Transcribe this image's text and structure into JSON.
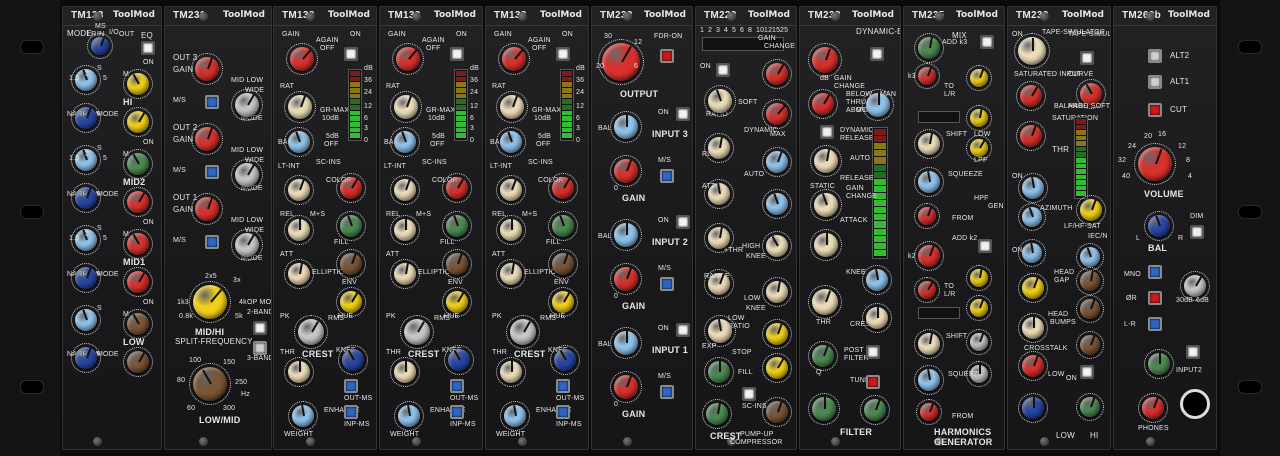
{
  "rack": {
    "brand": "ToolMod",
    "modules": [
      {
        "id": "tm133",
        "name": "TM133",
        "x": 0,
        "labels": [
          "MODE",
          "MS",
          "LR",
          "IN",
          "I/O",
          "OUT",
          "EQ",
          "HI",
          "S",
          "M",
          "MODE",
          "NARROW",
          "MID2",
          "S",
          "M",
          "MODE",
          "NARROW",
          "MID1",
          "S",
          "M",
          "MODE",
          "NARROW",
          "LOW",
          "S",
          "M",
          "MODE",
          "NARROW",
          "ON",
          "ON",
          "ON",
          "ON",
          "1.5",
          "3",
          "5",
          "1.5",
          "3",
          "5",
          "1.5",
          "3",
          "5"
        ]
      },
      {
        "id": "tm231",
        "name": "TM231",
        "labels": [
          "OUT 3",
          "GAIN",
          "M/S",
          "MID LOW",
          "WIDE",
          "MODE",
          "OUT 2",
          "GAIN",
          "M/S",
          "MID LOW",
          "WIDE",
          "MODE",
          "OUT 1",
          "GAIN",
          "M/S",
          "MID LOW",
          "WIDE",
          "MODE",
          "2x5",
          "3x",
          "1k3",
          "4k",
          "0.8k",
          "5k",
          "MID/HI",
          "SPLIT-FREQUENCY",
          "OP MODE",
          "2-BAND",
          "3-BAND",
          "100",
          "150",
          "80",
          "250",
          "60",
          "300",
          "Hz",
          "LOW/MID"
        ]
      },
      {
        "id": "tm132a",
        "name": "TM132",
        "labels": [
          "GAIN",
          "AGAIN",
          "OFF",
          "ON",
          "RAT",
          "GR-MAX",
          "10dB",
          "BAL",
          "5dB",
          "OFF",
          "SC-INS",
          "LT-INT",
          "COLOR",
          "REL",
          "M+S",
          "ATT",
          "ELLIPTIC",
          "FILL",
          "ENV",
          "HUE",
          "PK",
          "RMS",
          "CREST",
          "THR",
          "KNEE",
          "OUT-MS",
          "ENHANCE",
          "INP-MS",
          "WEIGHT",
          "dB",
          "36",
          "24",
          "12",
          "6",
          "3",
          "0"
        ]
      },
      {
        "id": "tm132b",
        "name": "TM132",
        "labels": [
          "GAIN",
          "AGAIN",
          "OFF",
          "ON",
          "RAT",
          "GR-MAX",
          "10dB",
          "BAL",
          "5dB",
          "OFF",
          "SC-INS",
          "LT-INT",
          "COLOR",
          "REL",
          "M+S",
          "ATT",
          "ELLIPTIC",
          "FILL",
          "ENV",
          "HUE",
          "PK",
          "RMS",
          "CREST",
          "THR",
          "KNEE",
          "OUT-MS",
          "ENHANCE",
          "INP-MS",
          "WEIGHT",
          "dB",
          "36",
          "24",
          "12",
          "6",
          "3",
          "0"
        ]
      },
      {
        "id": "tm132c",
        "name": "TM132",
        "labels": [
          "GAIN",
          "AGAIN",
          "OFF",
          "ON",
          "RAT",
          "GR-MAX",
          "10dB",
          "BAL",
          "5dB",
          "OFF",
          "SC-INS",
          "LT-INT",
          "COLOR",
          "REL",
          "M+S",
          "ATT",
          "ELLIPTIC",
          "FILL",
          "ENV",
          "HUE",
          "PK",
          "RMS",
          "CREST",
          "THR",
          "KNEE",
          "OUT-MS",
          "ENHANCE",
          "INP-MS",
          "WEIGHT",
          "dB",
          "36",
          "24",
          "12",
          "6",
          "3",
          "0"
        ]
      },
      {
        "id": "tm232",
        "name": "TM232",
        "labels": [
          "OUTPUT",
          "FDR-ON",
          "INPUT 3",
          "BAL",
          "GAIN",
          "M/S",
          "ON",
          "INPUT 2",
          "BAL",
          "GAIN",
          "M/S",
          "ON",
          "INPUT 1",
          "BAL",
          "GAIN",
          "M/S",
          "ON",
          "±dB",
          "0",
          "20",
          "30",
          "12",
          "6"
        ]
      },
      {
        "id": "tm223",
        "name": "TM223",
        "labels": [
          "GAIN",
          "CHANGE",
          "ON",
          "RATIO",
          "SOFT",
          "DYNAMIC",
          "MAX",
          "REL",
          "AUTO",
          "ATT",
          "+THR",
          "HIGH",
          "KNEE",
          "RANGE",
          "LOW",
          "KNEE",
          "LOW",
          "RATIO",
          "EXP",
          "STOP",
          "FILL",
          "SC-INS",
          "CREST",
          "PUMP-UP",
          "COMPRESSOR",
          "1",
          "2",
          "3",
          "4",
          "5",
          "6",
          "8",
          "10",
          "12",
          "15",
          "25"
        ]
      },
      {
        "id": "tm238",
        "name": "TM238",
        "labels": [
          "DYNAMIC-EQ",
          "GAIN",
          "CHANGE",
          "BELOW",
          "THRU",
          "ABOVE",
          "MODE",
          "MAN",
          "DYNAMIC",
          "RELEASE",
          "AUTO",
          "STATIC",
          "RELEASE",
          "GAIN",
          "CHANGE",
          "ATTACK",
          "KNEE",
          "THR",
          "CREST",
          "POST",
          "FILTER",
          "TUNE",
          "FILTER",
          "Q",
          "dB"
        ]
      },
      {
        "id": "tm235",
        "name": "TM235",
        "labels": [
          "MIX",
          "ADD k3",
          "TO",
          "L/R",
          "SHIFT",
          "SQUEEZE",
          "FROM",
          "ADD k2",
          "TO",
          "L/R",
          "SHIFT",
          "SQUEEZE",
          "FROM",
          "k3",
          "k2",
          "LOW",
          "LPF",
          "HPF",
          "HARMONICS",
          "GENERATOR"
        ]
      },
      {
        "id": "tm233",
        "name": "TM233",
        "labels": [
          "TAPE-SIMULATOR",
          "SATURATED INPUT",
          "CURVE",
          "BALANCE",
          "HARD SOFT",
          "SATURATION",
          "THR",
          "AZIMUTH",
          "LF/HF-SAT",
          "IEC/N",
          "HEAD",
          "GAP",
          "HEAD",
          "BUMPS",
          "CROSSTALK",
          "LOW",
          "HI",
          "ON",
          "ON",
          "ON",
          "ON"
        ]
      },
      {
        "id": "tm260b",
        "name": "TM260b",
        "labels": [
          "ALT2",
          "ALT1",
          "CUT",
          "VOLUME",
          "BAL",
          "DIM",
          "MNO",
          "ØR",
          "L-R",
          "30dB",
          "6dB",
          "INPUT2",
          "PHONES",
          "24",
          "20",
          "16",
          "12",
          "8",
          "4",
          "32",
          "40",
          "L",
          "R"
        ]
      }
    ]
  },
  "colors": {
    "panel": "#1b1b1d",
    "text": "#e6e6e6",
    "knob_blue": "#2747a8",
    "knob_lightblue": "#8fc3ec",
    "knob_red": "#d9302c",
    "knob_yellow": "#f0cf18",
    "knob_cream": "#ecdcb8",
    "knob_green": "#4c8a52",
    "knob_grey": "#c6c6c6",
    "knob_brown": "#7a5536",
    "button_red": "#c81b1b",
    "button_blue": "#2e66c4",
    "button_white": "#f2f2f2"
  }
}
